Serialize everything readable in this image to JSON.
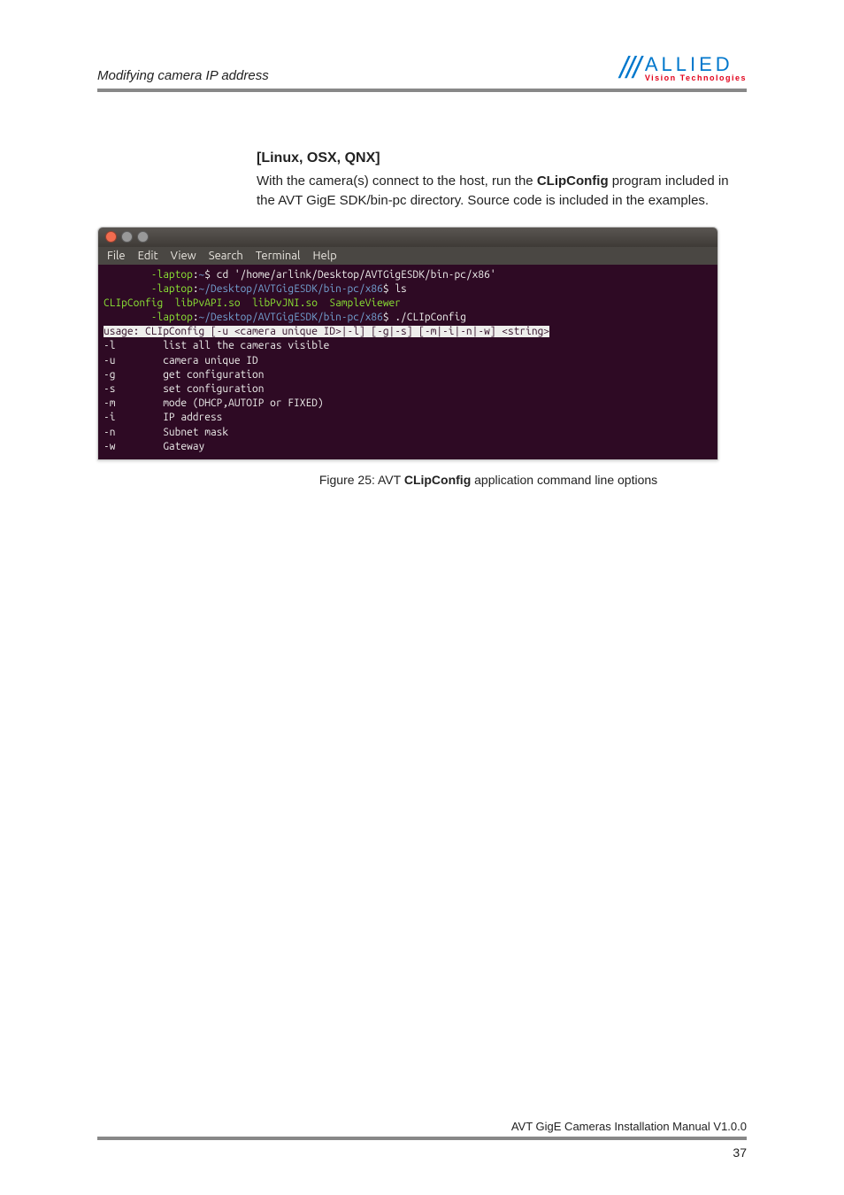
{
  "header": {
    "title": "Modifying camera IP address",
    "logo_top": "ALLIED",
    "logo_bottom": "Vision Technologies",
    "logo_slashes": "///"
  },
  "section": {
    "heading": "[Linux, OSX, QNX]",
    "paragraph_before_bold": "With the camera(s) connect to the host, run the ",
    "paragraph_bold": "CLipConfig",
    "paragraph_after_bold": " program included in the AVT GigE SDK/bin-pc directory. Source code is included in the examples."
  },
  "terminal": {
    "menu": [
      "File",
      "Edit",
      "View",
      "Search",
      "Terminal",
      "Help"
    ],
    "lines": [
      {
        "segments": [
          {
            "class": "term-green",
            "text": "        -laptop"
          },
          {
            "class": "term-white",
            "text": ":"
          },
          {
            "class": "term-blue",
            "text": "~"
          },
          {
            "class": "term-white",
            "text": "$ cd '/home/arlink/Desktop/AVTGigESDK/bin-pc/x86'"
          }
        ]
      },
      {
        "segments": [
          {
            "class": "term-green",
            "text": "        -laptop"
          },
          {
            "class": "term-white",
            "text": ":"
          },
          {
            "class": "term-blue",
            "text": "~/Desktop/AVTGigESDK/bin-pc/x86"
          },
          {
            "class": "term-white",
            "text": "$ ls"
          }
        ]
      },
      {
        "segments": [
          {
            "class": "term-green",
            "text": "CLIpConfig  libPvAPI.so  libPvJNI.so  SampleViewer"
          }
        ]
      },
      {
        "segments": [
          {
            "class": "term-green",
            "text": "        -laptop"
          },
          {
            "class": "term-white",
            "text": ":"
          },
          {
            "class": "term-blue",
            "text": "~/Desktop/AVTGigESDK/bin-pc/x86"
          },
          {
            "class": "term-white",
            "text": "$ ./CLIpConfig"
          }
        ]
      },
      {
        "segments": [
          {
            "class": "term-hl",
            "text": "usage: CLIpConfig [-u <camera unique ID>|-l] [-g|-s] [-m|-i|-n|-w] <string>"
          }
        ]
      },
      {
        "segments": [
          {
            "class": "term-white",
            "text": "-l        list all the cameras visible"
          }
        ]
      },
      {
        "segments": [
          {
            "class": "term-white",
            "text": "-u        camera unique ID"
          }
        ]
      },
      {
        "segments": [
          {
            "class": "term-white",
            "text": "-g        get configuration"
          }
        ]
      },
      {
        "segments": [
          {
            "class": "term-white",
            "text": "-s        set configuration"
          }
        ]
      },
      {
        "segments": [
          {
            "class": "term-white",
            "text": "-m        mode (DHCP,AUTOIP or FIXED)"
          }
        ]
      },
      {
        "segments": [
          {
            "class": "term-white",
            "text": "-i        IP address"
          }
        ]
      },
      {
        "segments": [
          {
            "class": "term-white",
            "text": "-n        Subnet mask"
          }
        ]
      },
      {
        "segments": [
          {
            "class": "term-white",
            "text": "-w        Gateway"
          }
        ]
      }
    ]
  },
  "figure": {
    "caption_prefix": "Figure 25: AVT ",
    "caption_bold": "CLipConfig",
    "caption_suffix": " application command line options"
  },
  "footer": {
    "text": "AVT GigE Cameras Installation Manual V1.0.0",
    "page": "37"
  }
}
